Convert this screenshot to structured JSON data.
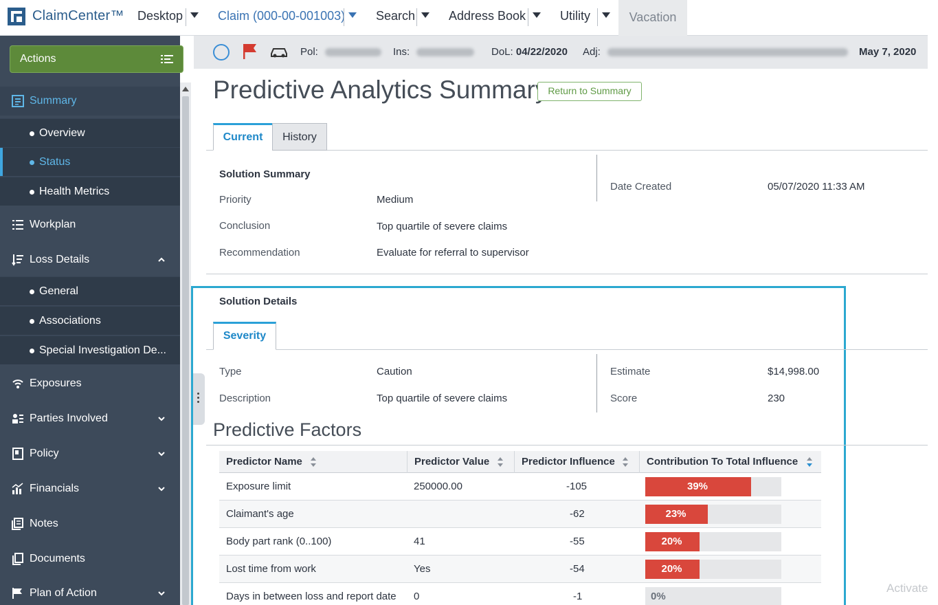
{
  "nav": {
    "brand": "ClaimCenter™",
    "items": [
      {
        "label": "Desktop"
      },
      {
        "label": "Claim (000-00-001003)"
      },
      {
        "label": "Search"
      },
      {
        "label": "Address Book"
      },
      {
        "label": "Utility"
      }
    ],
    "vacation": "Vacation"
  },
  "sidebar": {
    "actions_label": "Actions",
    "items": [
      {
        "label": "Summary",
        "icon": "summary-icon",
        "active": true
      },
      {
        "label": "Overview",
        "sub": true
      },
      {
        "label": "Status",
        "sub": true,
        "active": true
      },
      {
        "label": "Health Metrics",
        "sub": true
      },
      {
        "label": "Workplan",
        "icon": "workplan-icon"
      },
      {
        "label": "Loss Details",
        "icon": "loss-details-icon",
        "chevron": "up"
      },
      {
        "label": "General",
        "sub": true
      },
      {
        "label": "Associations",
        "sub": true
      },
      {
        "label": "Special Investigation De...",
        "sub": true
      },
      {
        "label": "Exposures",
        "icon": "exposures-icon"
      },
      {
        "label": "Parties Involved",
        "icon": "parties-icon",
        "chevron": "down"
      },
      {
        "label": "Policy",
        "icon": "policy-icon",
        "chevron": "down"
      },
      {
        "label": "Financials",
        "icon": "financials-icon",
        "chevron": "down"
      },
      {
        "label": "Notes",
        "icon": "notes-icon"
      },
      {
        "label": "Documents",
        "icon": "documents-icon"
      },
      {
        "label": "Plan of Action",
        "icon": "plan-icon",
        "chevron": "down"
      }
    ]
  },
  "infobar": {
    "pol_label": "Pol:",
    "ins_label": "Ins:",
    "dol_label": "DoL:",
    "dol_value": "04/22/2020",
    "adj_label": "Adj:",
    "date": "May 7, 2020"
  },
  "page": {
    "title": "Predictive Analytics Summary",
    "return_button": "Return to Summary",
    "tabs": [
      {
        "label": "Current"
      },
      {
        "label": "History"
      }
    ]
  },
  "solution_summary": {
    "heading": "Solution Summary",
    "priority_label": "Priority",
    "priority_value": "Medium",
    "conclusion_label": "Conclusion",
    "conclusion_value": "Top quartile of severe claims",
    "recommendation_label": "Recommendation",
    "recommendation_value": "Evaluate for referral to supervisor",
    "date_created_label": "Date Created",
    "date_created_value": "05/07/2020 11:33 AM"
  },
  "solution_details": {
    "heading": "Solution Details",
    "tab": "Severity",
    "type_label": "Type",
    "type_value": "Caution",
    "description_label": "Description",
    "description_value": "Top quartile of severe claims",
    "estimate_label": "Estimate",
    "estimate_value": "$14,998.00",
    "score_label": "Score",
    "score_value": "230"
  },
  "predictive_factors": {
    "title": "Predictive Factors",
    "columns": [
      "Predictor Name",
      "Predictor Value",
      "Predictor Influence",
      "Contribution To Total Influence"
    ],
    "rows": [
      {
        "name": "Exposure limit",
        "value": "250000.00",
        "influence": "-105",
        "contribution": "39%",
        "pct": 39
      },
      {
        "name": "Claimant's age",
        "value": "",
        "influence": "-62",
        "contribution": "23%",
        "pct": 23
      },
      {
        "name": "Body part rank (0..100)",
        "value": "41",
        "influence": "-55",
        "contribution": "20%",
        "pct": 20
      },
      {
        "name": "Lost time from work",
        "value": "Yes",
        "influence": "-54",
        "contribution": "20%",
        "pct": 20
      },
      {
        "name": "Days in between loss and report date",
        "value": "0",
        "influence": "-1",
        "contribution": "0%",
        "pct": 0
      }
    ]
  },
  "watermark": "Activate",
  "colors": {
    "sidebar_bg": "#3d4a5a",
    "accent_blue": "#2aa0d8",
    "actions_green": "#5d8a3a",
    "bar_red": "#d9473c",
    "highlight": "#2ba8d0"
  }
}
